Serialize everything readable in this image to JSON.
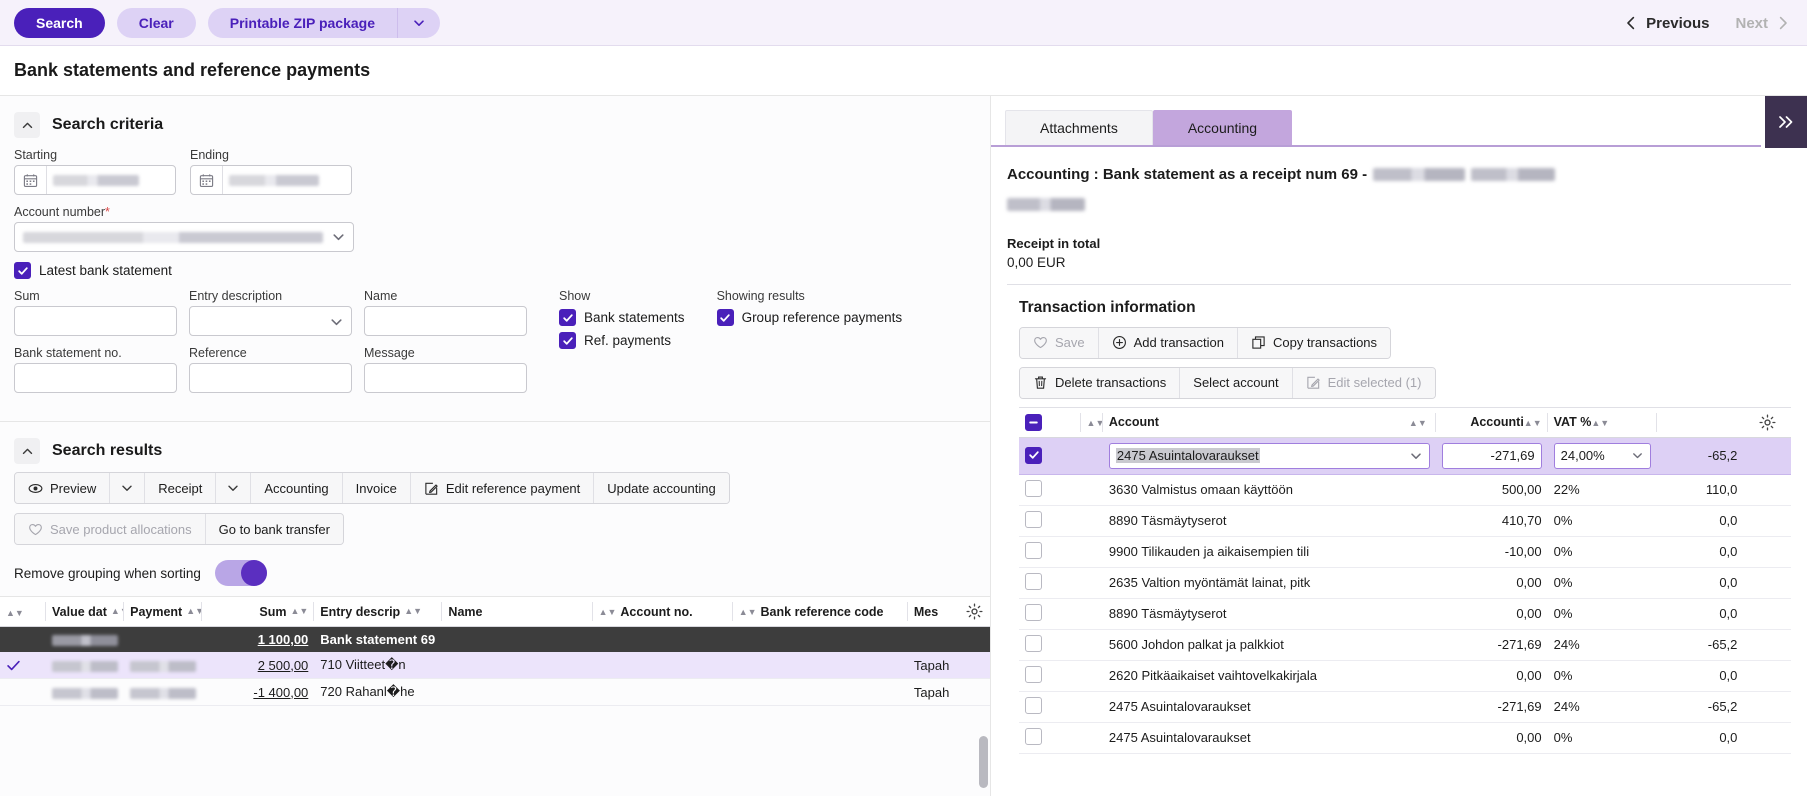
{
  "toolbar": {
    "search_label": "Search",
    "clear_label": "Clear",
    "zip_label": "Printable ZIP package",
    "previous_label": "Previous",
    "next_label": "Next"
  },
  "page": {
    "title": "Bank statements and reference payments"
  },
  "search_criteria": {
    "title": "Search criteria",
    "starting_label": "Starting",
    "ending_label": "Ending",
    "account_number_label": "Account number",
    "latest_bank_statement_label": "Latest bank statement",
    "latest_bank_statement_checked": true,
    "sum_label": "Sum",
    "sum_value": "",
    "entry_description_label": "Entry description",
    "entry_description_value": "",
    "name_label": "Name",
    "name_value": "",
    "bank_statement_no_label": "Bank statement no.",
    "bank_statement_no_value": "",
    "reference_label": "Reference",
    "reference_value": "",
    "message_label": "Message",
    "message_value": "",
    "show_label": "Show",
    "show_bank_statements_label": "Bank statements",
    "show_bank_statements_checked": true,
    "show_ref_payments_label": "Ref. payments",
    "show_ref_payments_checked": true,
    "showing_results_label": "Showing results",
    "group_reference_payments_label": "Group reference payments",
    "group_reference_payments_checked": true
  },
  "search_results": {
    "title": "Search results",
    "buttons_row1": [
      "Preview",
      "Receipt",
      "Accounting",
      "Invoice",
      "Edit reference payment",
      "Update accounting"
    ],
    "preview_label": "Preview",
    "receipt_label": "Receipt",
    "accounting_label": "Accounting",
    "invoice_label": "Invoice",
    "edit_reference_payment_label": "Edit reference payment",
    "update_accounting_label": "Update accounting",
    "save_product_allocations_label": "Save product allocations",
    "go_to_bank_transfer_label": "Go to bank transfer",
    "remove_grouping_label": "Remove grouping when sorting",
    "remove_grouping_on": true,
    "columns": [
      "Value dat",
      "Payment",
      "Sum",
      "Entry descrip",
      "Name",
      "Account no.",
      "Bank reference code",
      "Mes"
    ],
    "group_row_label": "Bank statement 69",
    "group_row_sum": "1 100,00",
    "rows": [
      {
        "selected": true,
        "sum": "2 500,00",
        "entry_description": "710 Viitteet�n",
        "message": "Tapah"
      },
      {
        "selected": false,
        "sum": "-1 400,00",
        "entry_description": "720 Rahanl�he",
        "message": "Tapah"
      }
    ]
  },
  "right_panel": {
    "tabs": [
      {
        "label": "Attachments",
        "active": false
      },
      {
        "label": "Accounting",
        "active": true
      }
    ],
    "heading": "Accounting : Bank statement as a receipt num 69 -",
    "receipt_in_total_label": "Receipt in total",
    "receipt_in_total_value": "0,00 EUR",
    "transaction_information_title": "Transaction information",
    "buttons_row1": [
      "Save",
      "Add transaction",
      "Copy transactions"
    ],
    "save_label": "Save",
    "add_transaction_label": "Add transaction",
    "copy_transactions_label": "Copy transactions",
    "delete_transactions_label": "Delete transactions",
    "select_account_label": "Select account",
    "edit_selected_label": "Edit selected (1)",
    "columns": [
      "Account",
      "Accounti",
      "VAT %",
      ""
    ],
    "rows": [
      {
        "selected": true,
        "editing": true,
        "account": "2475 Asuintalovaraukset",
        "amount": "-271,69",
        "vat": "24,00%",
        "vat_amount": "-65,2"
      },
      {
        "selected": false,
        "editing": false,
        "account": "3630 Valmistus omaan käyttöön",
        "amount": "500,00",
        "vat": "22%",
        "vat_amount": "110,0"
      },
      {
        "selected": false,
        "editing": false,
        "account": "8890 Täsmäytyserot",
        "amount": "410,70",
        "vat": "0%",
        "vat_amount": "0,0"
      },
      {
        "selected": false,
        "editing": false,
        "account": "9900 Tilikauden ja aikaisempien tili",
        "amount": "-10,00",
        "vat": "0%",
        "vat_amount": "0,0"
      },
      {
        "selected": false,
        "editing": false,
        "account": "2635 Valtion myöntämät lainat, pitk",
        "amount": "0,00",
        "vat": "0%",
        "vat_amount": "0,0"
      },
      {
        "selected": false,
        "editing": false,
        "account": "8890 Täsmäytyserot",
        "amount": "0,00",
        "vat": "0%",
        "vat_amount": "0,0"
      },
      {
        "selected": false,
        "editing": false,
        "account": "5600 Johdon palkat ja palkkiot",
        "amount": "-271,69",
        "vat": "24%",
        "vat_amount": "-65,2"
      },
      {
        "selected": false,
        "editing": false,
        "account": "2620 Pitkäaikaiset vaihtovelkakirjala",
        "amount": "0,00",
        "vat": "0%",
        "vat_amount": "0,0"
      },
      {
        "selected": false,
        "editing": false,
        "account": "2475 Asuintalovaraukset",
        "amount": "-271,69",
        "vat": "24%",
        "vat_amount": "-65,2"
      },
      {
        "selected": false,
        "editing": false,
        "account": "2475 Asuintalovaraukset",
        "amount": "0,00",
        "vat": "0%",
        "vat_amount": "0,0"
      }
    ]
  },
  "colors": {
    "primary": "#4a20ba",
    "primary_light": "#ddd2f5",
    "tab_active": "#c3a6dd",
    "row_selected": "#ddd0f5",
    "group_row": "#3d3d3d"
  }
}
